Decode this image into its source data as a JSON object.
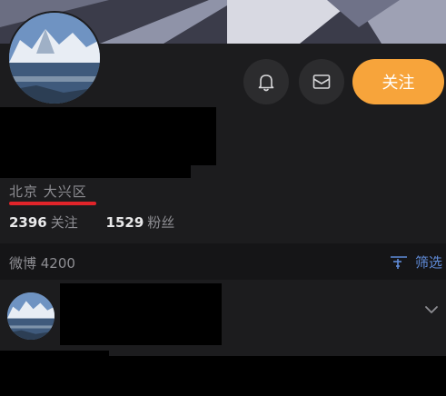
{
  "profile": {
    "location": "北京 大兴区",
    "follow_button_label": "关注",
    "stats": [
      {
        "count": "2396",
        "label": "关注"
      },
      {
        "count": "1529",
        "label": "粉丝"
      }
    ]
  },
  "feed": {
    "label": "微博 4200",
    "filter_label": "筛选"
  },
  "colors": {
    "background": "#1c1c1e",
    "accent_orange": "#f7a43b",
    "link_blue": "#5f8bd8",
    "underline_red": "#e1242a"
  },
  "icons": {
    "bell": "bell-icon",
    "message": "message-icon",
    "filter": "filter-icon",
    "chevron": "chevron-down-icon"
  }
}
